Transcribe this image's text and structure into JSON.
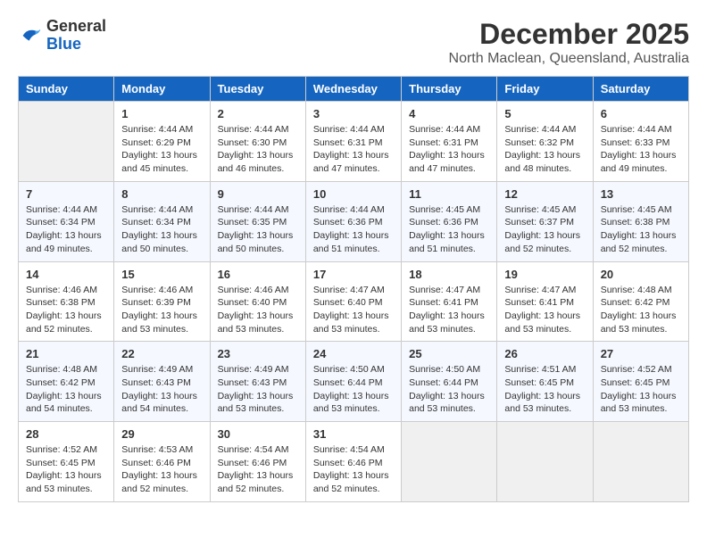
{
  "header": {
    "logo_general": "General",
    "logo_blue": "Blue",
    "month_title": "December 2025",
    "location": "North Maclean, Queensland, Australia"
  },
  "days_of_week": [
    "Sunday",
    "Monday",
    "Tuesday",
    "Wednesday",
    "Thursday",
    "Friday",
    "Saturday"
  ],
  "weeks": [
    [
      {
        "day": "",
        "empty": true
      },
      {
        "day": "1",
        "sunrise": "4:44 AM",
        "sunset": "6:29 PM",
        "daylight": "13 hours and 45 minutes."
      },
      {
        "day": "2",
        "sunrise": "4:44 AM",
        "sunset": "6:30 PM",
        "daylight": "13 hours and 46 minutes."
      },
      {
        "day": "3",
        "sunrise": "4:44 AM",
        "sunset": "6:31 PM",
        "daylight": "13 hours and 47 minutes."
      },
      {
        "day": "4",
        "sunrise": "4:44 AM",
        "sunset": "6:31 PM",
        "daylight": "13 hours and 47 minutes."
      },
      {
        "day": "5",
        "sunrise": "4:44 AM",
        "sunset": "6:32 PM",
        "daylight": "13 hours and 48 minutes."
      },
      {
        "day": "6",
        "sunrise": "4:44 AM",
        "sunset": "6:33 PM",
        "daylight": "13 hours and 49 minutes."
      }
    ],
    [
      {
        "day": "7",
        "sunrise": "4:44 AM",
        "sunset": "6:34 PM",
        "daylight": "13 hours and 49 minutes."
      },
      {
        "day": "8",
        "sunrise": "4:44 AM",
        "sunset": "6:34 PM",
        "daylight": "13 hours and 50 minutes."
      },
      {
        "day": "9",
        "sunrise": "4:44 AM",
        "sunset": "6:35 PM",
        "daylight": "13 hours and 50 minutes."
      },
      {
        "day": "10",
        "sunrise": "4:44 AM",
        "sunset": "6:36 PM",
        "daylight": "13 hours and 51 minutes."
      },
      {
        "day": "11",
        "sunrise": "4:45 AM",
        "sunset": "6:36 PM",
        "daylight": "13 hours and 51 minutes."
      },
      {
        "day": "12",
        "sunrise": "4:45 AM",
        "sunset": "6:37 PM",
        "daylight": "13 hours and 52 minutes."
      },
      {
        "day": "13",
        "sunrise": "4:45 AM",
        "sunset": "6:38 PM",
        "daylight": "13 hours and 52 minutes."
      }
    ],
    [
      {
        "day": "14",
        "sunrise": "4:46 AM",
        "sunset": "6:38 PM",
        "daylight": "13 hours and 52 minutes."
      },
      {
        "day": "15",
        "sunrise": "4:46 AM",
        "sunset": "6:39 PM",
        "daylight": "13 hours and 53 minutes."
      },
      {
        "day": "16",
        "sunrise": "4:46 AM",
        "sunset": "6:40 PM",
        "daylight": "13 hours and 53 minutes."
      },
      {
        "day": "17",
        "sunrise": "4:47 AM",
        "sunset": "6:40 PM",
        "daylight": "13 hours and 53 minutes."
      },
      {
        "day": "18",
        "sunrise": "4:47 AM",
        "sunset": "6:41 PM",
        "daylight": "13 hours and 53 minutes."
      },
      {
        "day": "19",
        "sunrise": "4:47 AM",
        "sunset": "6:41 PM",
        "daylight": "13 hours and 53 minutes."
      },
      {
        "day": "20",
        "sunrise": "4:48 AM",
        "sunset": "6:42 PM",
        "daylight": "13 hours and 53 minutes."
      }
    ],
    [
      {
        "day": "21",
        "sunrise": "4:48 AM",
        "sunset": "6:42 PM",
        "daylight": "13 hours and 54 minutes."
      },
      {
        "day": "22",
        "sunrise": "4:49 AM",
        "sunset": "6:43 PM",
        "daylight": "13 hours and 54 minutes."
      },
      {
        "day": "23",
        "sunrise": "4:49 AM",
        "sunset": "6:43 PM",
        "daylight": "13 hours and 53 minutes."
      },
      {
        "day": "24",
        "sunrise": "4:50 AM",
        "sunset": "6:44 PM",
        "daylight": "13 hours and 53 minutes."
      },
      {
        "day": "25",
        "sunrise": "4:50 AM",
        "sunset": "6:44 PM",
        "daylight": "13 hours and 53 minutes."
      },
      {
        "day": "26",
        "sunrise": "4:51 AM",
        "sunset": "6:45 PM",
        "daylight": "13 hours and 53 minutes."
      },
      {
        "day": "27",
        "sunrise": "4:52 AM",
        "sunset": "6:45 PM",
        "daylight": "13 hours and 53 minutes."
      }
    ],
    [
      {
        "day": "28",
        "sunrise": "4:52 AM",
        "sunset": "6:45 PM",
        "daylight": "13 hours and 53 minutes."
      },
      {
        "day": "29",
        "sunrise": "4:53 AM",
        "sunset": "6:46 PM",
        "daylight": "13 hours and 52 minutes."
      },
      {
        "day": "30",
        "sunrise": "4:54 AM",
        "sunset": "6:46 PM",
        "daylight": "13 hours and 52 minutes."
      },
      {
        "day": "31",
        "sunrise": "4:54 AM",
        "sunset": "6:46 PM",
        "daylight": "13 hours and 52 minutes."
      },
      {
        "day": "",
        "empty": true
      },
      {
        "day": "",
        "empty": true
      },
      {
        "day": "",
        "empty": true
      }
    ]
  ],
  "labels": {
    "sunrise_label": "Sunrise:",
    "sunset_label": "Sunset:",
    "daylight_label": "Daylight:"
  }
}
